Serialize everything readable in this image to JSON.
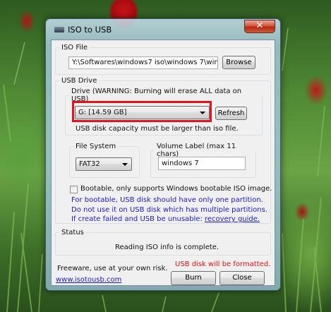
{
  "window": {
    "title": "ISO to USB",
    "close_glyph": "✕"
  },
  "iso_file": {
    "group_label": "ISO File",
    "path_value": "Y:\\Softwares\\windows7 iso\\windows 7\\windo",
    "browse_label": "Browse"
  },
  "usb_drive": {
    "group_label": "USB Drive",
    "drive_group_label": "Drive (WARNING: Burning will erase ALL data on USB)",
    "selected_drive": "G: [14.59 GB]",
    "refresh_label": "Refresh",
    "capacity_note": "USB disk capacity must be larger than iso file.",
    "highlight_color": "#e0161c"
  },
  "file_system": {
    "group_label": "File System",
    "selected": "FAT32"
  },
  "volume_label": {
    "group_label": "Volume Label (max 11 chars)",
    "value": "windows 7"
  },
  "bootable": {
    "checked": false,
    "label": "Bootable, only supports Windows bootable ISO image.",
    "note_line1": "For bootable, USB disk should have only one partition.",
    "note_line2": "Do not use it on USB disk which has multiple partitions.",
    "note_line3_prefix": "If create failed and USB be unusable: ",
    "recovery_link": "recovery guide."
  },
  "status": {
    "group_label": "Status",
    "message": "Reading ISO info is complete."
  },
  "footer": {
    "freeware_text": "Freeware, use at your own risk.",
    "warning_text": "USB disk will be formatted.",
    "website_link": "www.isotousb.com",
    "burn_label": "Burn",
    "close_label": "Close"
  },
  "colors": {
    "link_blue": "#1a1acc",
    "warning_red": "#e01010"
  },
  "icons": [
    "app-icon",
    "close-icon",
    "dropdown-arrow-icon",
    "checkbox-icon"
  ]
}
